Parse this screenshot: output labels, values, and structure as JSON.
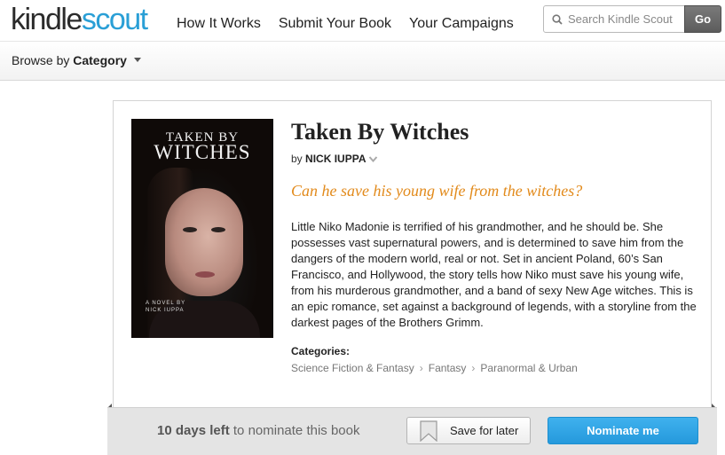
{
  "header": {
    "logo_part1": "kindle",
    "logo_part2": "scout",
    "nav": [
      "How It Works",
      "Submit Your Book",
      "Your Campaigns"
    ],
    "search_placeholder": "Search Kindle Scout",
    "go_label": "Go"
  },
  "browse": {
    "prefix": "Browse by",
    "label": "Category"
  },
  "book": {
    "cover": {
      "title_line1": "TAKEN BY",
      "title_line2": "WITCHES",
      "subtitle": "A NOVEL BY NICK IUPPA"
    },
    "title": "Taken By Witches",
    "by": "by",
    "author": "NICK IUPPA",
    "tagline": "Can he save his young wife from the witches?",
    "description": "Little Niko Madonie is terrified of his grandmother, and he should be. She possesses vast supernatural powers, and is determined to save him from the dangers of the modern world, real or not. Set in ancient Poland, 60’s San Francisco, and Hollywood, the story tells how Niko must save his young wife, from his murderous grandmother, and a band of sexy New Age witches. This is an epic romance, set against a background of legends, with a storyline from the darkest pages of the Brothers Grimm.",
    "categories_label": "Categories:",
    "categories": [
      "Science Fiction & Fantasy",
      "Fantasy",
      "Paranormal & Urban"
    ]
  },
  "nominate": {
    "days_bold": "10 days left",
    "days_rest": " to nominate this book",
    "save_label": "Save for later",
    "nominate_label": "Nominate me"
  },
  "colors": {
    "accent": "#2a9fd6",
    "tagline": "#e28a1b",
    "nominate_button": "#2599dc"
  },
  "icons": [
    "search-icon",
    "caret-down-icon",
    "chevron-down-icon",
    "bookmark-icon"
  ]
}
